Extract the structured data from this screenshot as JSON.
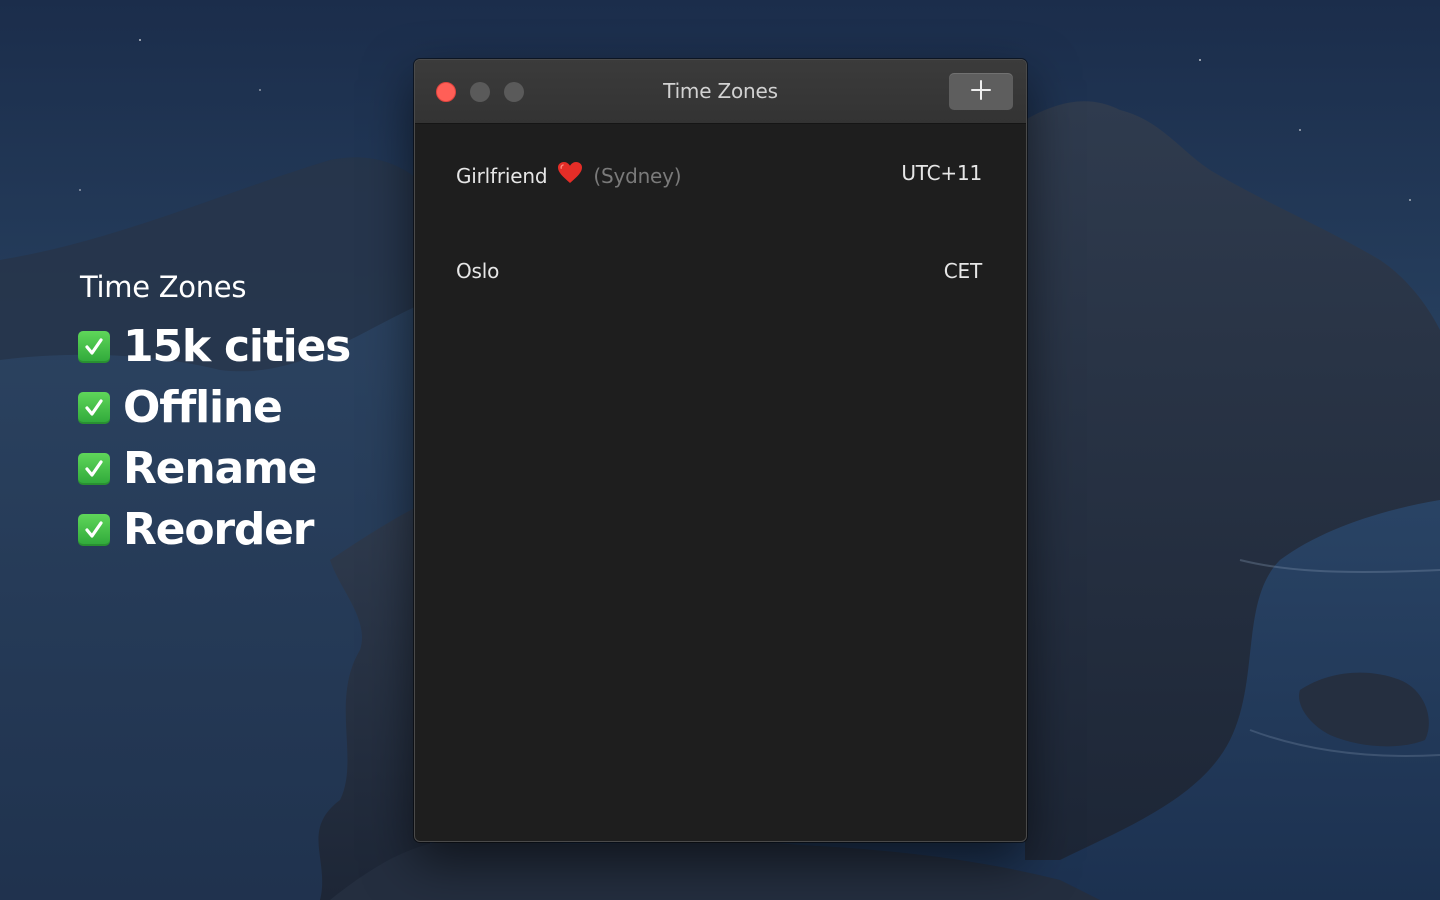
{
  "promo": {
    "title": "Time Zones",
    "features": [
      {
        "label": "15k cities"
      },
      {
        "label": "Offline"
      },
      {
        "label": "Rename"
      },
      {
        "label": "Reorder"
      }
    ]
  },
  "window": {
    "title": "Time Zones",
    "add_button_icon": "plus-icon"
  },
  "zones": [
    {
      "name": "Girlfriend",
      "emoji_icon": "red-heart-icon",
      "city": "(Sydney)",
      "offset": "UTC+11"
    },
    {
      "name": "Oslo",
      "city": "",
      "offset": "CET"
    }
  ],
  "colors": {
    "close_button": "#ff5f57",
    "window_background": "#1e1e1e",
    "titlebar": "#363636",
    "check_green": "#3cb043",
    "heart_red": "#e52d27"
  }
}
